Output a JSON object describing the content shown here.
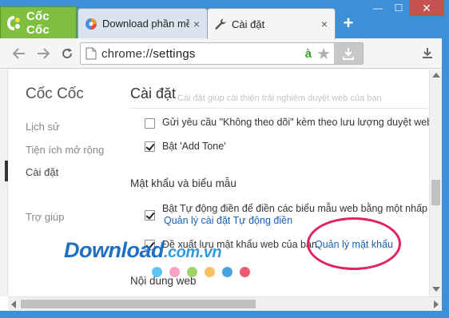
{
  "browser": {
    "brand_name": "Cốc Cốc",
    "tabs": [
      {
        "title": "Download phần mềm",
        "close": "×"
      },
      {
        "title": "Cài đặt",
        "close": "×"
      }
    ],
    "new_tab": "+",
    "window": {
      "minimize": "—",
      "maximize": "☐",
      "close": "✕"
    }
  },
  "toolbar": {
    "url_scheme": "chrome://",
    "url_host": "settings",
    "ime_indicator": "à",
    "bookmark_star": "★"
  },
  "sidebar": {
    "title": "Cốc Cốc",
    "items": [
      {
        "label": "Lịch sử",
        "active": false
      },
      {
        "label": "Tiện ích mở rộng",
        "active": false
      },
      {
        "label": "Cài đặt",
        "active": true
      },
      {
        "label": "Trợ giúp",
        "active": false
      }
    ]
  },
  "settings": {
    "page_title": "Cài đặt",
    "scrolled_hint": "Cài đặt giúp cải thiện trải nghiệm duyệt web của bạn",
    "privacy_options": [
      {
        "label": "Gửi yêu cầu \"Không theo dõi\" kèm theo lưu lượng duyệt web của bạn",
        "checked": false
      },
      {
        "label": "Bật 'Add Tone'",
        "checked": true
      }
    ],
    "passwords_section": {
      "heading": "Mật khẩu và biểu mẫu",
      "autofill_label": "Bật Tự động điền để điền các biểu mẫu web bằng một nhấp chuột",
      "autofill_checked": true,
      "autofill_link": "Quản lý cài đặt Tự động điền",
      "save_password_label": "Đề xuất lưu mật khẩu web của bạn.",
      "save_password_checked": true,
      "manage_passwords_link": "Quản lý mật khẩu"
    },
    "content_section": {
      "heading": "Nội dung web"
    }
  },
  "watermark": {
    "text": "Download",
    "domain": ".com.vn",
    "dot_colors": [
      "#5bc4f1",
      "#f7a1c4",
      "#9fd36a",
      "#f9c063",
      "#4aa3df",
      "#ee5a6f"
    ]
  },
  "colors": {
    "frame": "#3d8fd8",
    "brand_tab": "#7fbf3f",
    "link": "#1a5fb4",
    "highlight": "#e0245e"
  }
}
